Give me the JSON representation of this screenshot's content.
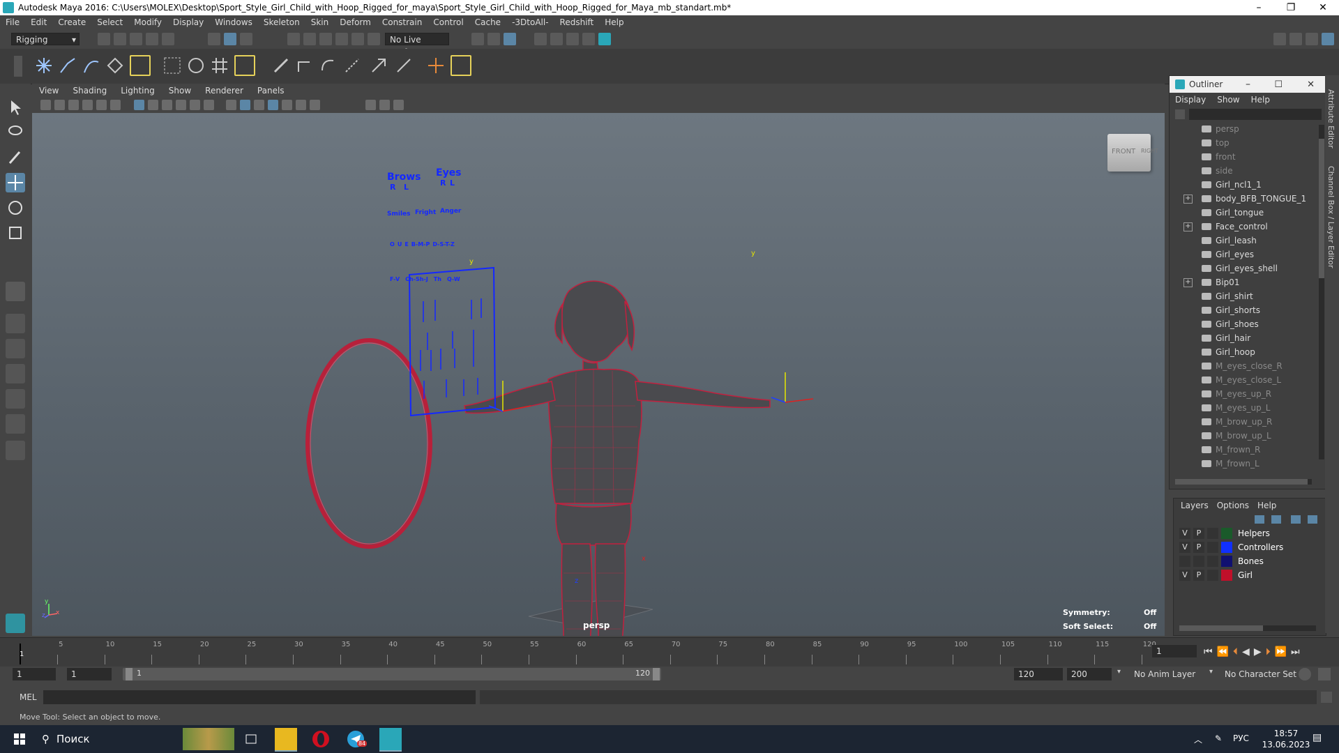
{
  "window": {
    "title": "Autodesk Maya 2016: C:\\Users\\MOLEX\\Desktop\\Sport_Style_Girl_Child_with_Hoop_Rigged_for_maya\\Sport_Style_Girl_Child_with_Hoop_Rigged_for_Maya_mb_standart.mb*",
    "controls": {
      "minimize": "–",
      "maximize": "❐",
      "close": "✕"
    }
  },
  "menubar": [
    "File",
    "Edit",
    "Create",
    "Select",
    "Modify",
    "Display",
    "Windows",
    "Skeleton",
    "Skin",
    "Deform",
    "Constrain",
    "Control",
    "Cache",
    "-3DtoAll-",
    "Redshift",
    "Help"
  ],
  "statusline": {
    "mode": "Rigging",
    "live_surface": "No Live Surface"
  },
  "viewport": {
    "menu": [
      "View",
      "Shading",
      "Lighting",
      "Show",
      "Renderer",
      "Panels"
    ],
    "camera_label": "persp",
    "viewcube": {
      "front": "FRONT",
      "right": "RIGHT"
    },
    "hud": {
      "symmetry_label": "Symmetry:",
      "symmetry_value": "Off",
      "soft_select_label": "Soft Select:",
      "soft_select_value": "Off"
    },
    "face_panel": {
      "brows": "Brows",
      "eyes": "Eyes",
      "r1": "R",
      "l1": "L",
      "r2": "R",
      "l2": "L",
      "smiles": "Smiles",
      "fright": "Fright",
      "anger": "Anger",
      "row2": [
        "O",
        "U",
        "E",
        "B-M-P",
        "D-S-T-Z"
      ],
      "row3": [
        "F-V",
        "Ch-Sh-J",
        "Th",
        "Q-W"
      ]
    },
    "axis": {
      "y": "y",
      "x": "x",
      "z": "z"
    }
  },
  "outliner": {
    "title": "Outliner",
    "menu": [
      "Display",
      "Show",
      "Help"
    ],
    "items": [
      {
        "label": "persp",
        "dim": true,
        "expand": false
      },
      {
        "label": "top",
        "dim": true,
        "expand": false
      },
      {
        "label": "front",
        "dim": true,
        "expand": false
      },
      {
        "label": "side",
        "dim": true,
        "expand": false
      },
      {
        "label": "Girl_ncl1_1",
        "dim": false,
        "expand": false
      },
      {
        "label": "body_BFB_TONGUE_1",
        "dim": false,
        "expand": true
      },
      {
        "label": "Girl_tongue",
        "dim": false,
        "expand": false
      },
      {
        "label": "Face_control",
        "dim": false,
        "expand": true
      },
      {
        "label": "Girl_leash",
        "dim": false,
        "expand": false
      },
      {
        "label": "Girl_eyes",
        "dim": false,
        "expand": false
      },
      {
        "label": "Girl_eyes_shell",
        "dim": false,
        "expand": false
      },
      {
        "label": "Bip01",
        "dim": false,
        "expand": true
      },
      {
        "label": "Girl_shirt",
        "dim": false,
        "expand": false
      },
      {
        "label": "Girl_shorts",
        "dim": false,
        "expand": false
      },
      {
        "label": "Girl_shoes",
        "dim": false,
        "expand": false
      },
      {
        "label": "Girl_hair",
        "dim": false,
        "expand": false
      },
      {
        "label": "Girl_hoop",
        "dim": false,
        "expand": false
      },
      {
        "label": "M_eyes_close_R",
        "dim": true,
        "expand": false
      },
      {
        "label": "M_eyes_close_L",
        "dim": true,
        "expand": false
      },
      {
        "label": "M_eyes_up_R",
        "dim": true,
        "expand": false
      },
      {
        "label": "M_eyes_up_L",
        "dim": true,
        "expand": false
      },
      {
        "label": "M_brow_up_R",
        "dim": true,
        "expand": false
      },
      {
        "label": "M_brow_up_L",
        "dim": true,
        "expand": false
      },
      {
        "label": "M_frown_R",
        "dim": true,
        "expand": false
      },
      {
        "label": "M_frown_L",
        "dim": true,
        "expand": false
      }
    ]
  },
  "layers": {
    "menu": [
      "Layers",
      "Options",
      "Help"
    ],
    "rows": [
      {
        "v": "V",
        "p": "P",
        "name": "Helpers",
        "color": "#1a5a2a"
      },
      {
        "v": "V",
        "p": "P",
        "name": "Controllers",
        "color": "#1030ff"
      },
      {
        "v": "",
        "p": "",
        "name": "Bones",
        "color": "#101070"
      },
      {
        "v": "V",
        "p": "P",
        "name": "Girl",
        "color": "#c0102a"
      }
    ]
  },
  "timeline": {
    "ticks": [
      "5",
      "10",
      "15",
      "20",
      "25",
      "30",
      "35",
      "40",
      "45",
      "50",
      "55",
      "60",
      "65",
      "70",
      "75",
      "80",
      "85",
      "90",
      "95",
      "100",
      "105",
      "110",
      "115",
      "120"
    ],
    "start_marker": "1",
    "current_frame": "1"
  },
  "range": {
    "start": "1",
    "anim_start": "1",
    "slider_start": "1",
    "slider_end": "120",
    "anim_end": "120",
    "end": "200",
    "anim_layer": "No Anim Layer",
    "character_set": "No Character Set"
  },
  "mel": {
    "label": "MEL"
  },
  "helpline": {
    "text": "Move Tool: Select an object to move."
  },
  "sidetabs": [
    "Attribute Editor",
    "Channel Box / Layer Editor"
  ],
  "taskbar": {
    "search": "Поиск",
    "lang": "РУС",
    "time": "18:57",
    "date": "13.06.2023",
    "badge": "84"
  }
}
